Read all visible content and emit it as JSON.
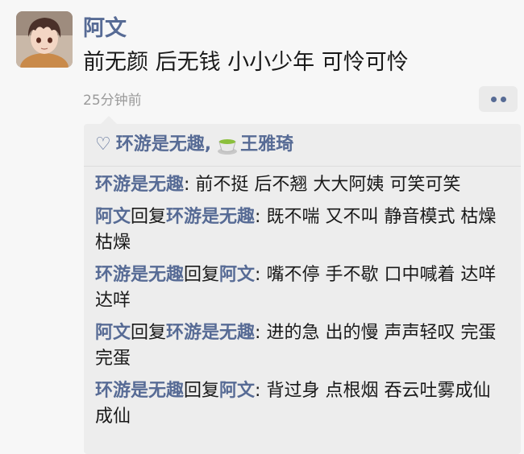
{
  "post": {
    "author": "阿文",
    "text": "前无颜 后无钱 小小少年 可怜可怜",
    "time": "25分钟前"
  },
  "likes": {
    "users": [
      "环游是无趣",
      "王雅琦"
    ],
    "separator": ","
  },
  "comments": [
    {
      "from": "环游是无趣",
      "reply_word": "",
      "to": "",
      "colon": ": ",
      "text": "前不挺 后不翘 大大阿姨 可笑可笑"
    },
    {
      "from": "阿文",
      "reply_word": "回复",
      "to": "环游是无趣",
      "colon": ": ",
      "text": "既不喘 又不叫 静音模式 枯燥枯燥"
    },
    {
      "from": "环游是无趣",
      "reply_word": "回复",
      "to": "阿文",
      "colon": ": ",
      "text": "嘴不停 手不歇 口中喊着 达咩达咩"
    },
    {
      "from": "阿文",
      "reply_word": "回复",
      "to": "环游是无趣",
      "colon": ": ",
      "text": "进的急 出的慢 声声轻叹 完蛋完蛋"
    },
    {
      "from": "环游是无趣",
      "reply_word": "回复",
      "to": "阿文",
      "colon": ": ",
      "text": "背过身 点根烟  吞云吐雾成仙成仙"
    }
  ],
  "colors": {
    "name": "#576b95",
    "text": "#191919",
    "time": "#9a9a9a",
    "panel": "#ededed"
  },
  "icons": {
    "avatar": "anime-boy-avatar",
    "like": "heart-outline-icon",
    "like_user_avatar": "tea-cup-icon",
    "more": "more-dots-icon"
  }
}
